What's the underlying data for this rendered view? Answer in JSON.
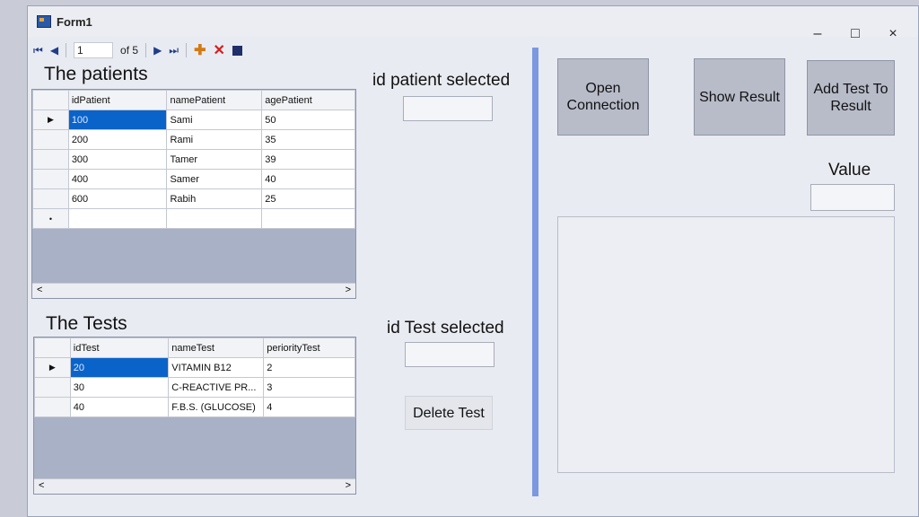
{
  "window": {
    "title": "Form1",
    "min": "–",
    "max": "□",
    "close": "×"
  },
  "navigator": {
    "first": "⏮",
    "prev": "◀",
    "position": "1",
    "of": "of 5",
    "next": "▶",
    "last": "⏭",
    "add": "✚",
    "delete": "✕"
  },
  "patients": {
    "title": "The patients",
    "columns": [
      "idPatient",
      "namePatient",
      "agePatient"
    ],
    "rows": [
      [
        "100",
        "Sami",
        "50"
      ],
      [
        "200",
        "Rami",
        "35"
      ],
      [
        "300",
        "Tamer",
        "39"
      ],
      [
        "400",
        "Samer",
        "40"
      ],
      [
        "600",
        "Rabih",
        "25"
      ]
    ],
    "current_marker": "▶",
    "new_marker": "•",
    "scroll_left": "<",
    "scroll_right": ">"
  },
  "tests": {
    "title": "The Tests",
    "columns": [
      "idTest",
      "nameTest",
      "periorityTest"
    ],
    "rows": [
      [
        "20",
        "VITAMIN B12",
        "2"
      ],
      [
        "30",
        "C-REACTIVE PR...",
        "3"
      ],
      [
        "40",
        "F.B.S. (GLUCOSE)",
        "4"
      ]
    ],
    "current_marker": "▶",
    "scroll_left": "<",
    "scroll_right": ">"
  },
  "id_patient_selected": {
    "label": "id patient selected",
    "value": ""
  },
  "id_test_selected": {
    "label": "id Test selected",
    "value": ""
  },
  "buttons": {
    "open_connection": "Open Connection",
    "show_result": "Show Result",
    "add_test_to_result": "Add Test To Result",
    "delete_test": "Delete Test"
  },
  "value_field": {
    "label": "Value",
    "value": ""
  },
  "result_box": {
    "value": ""
  }
}
